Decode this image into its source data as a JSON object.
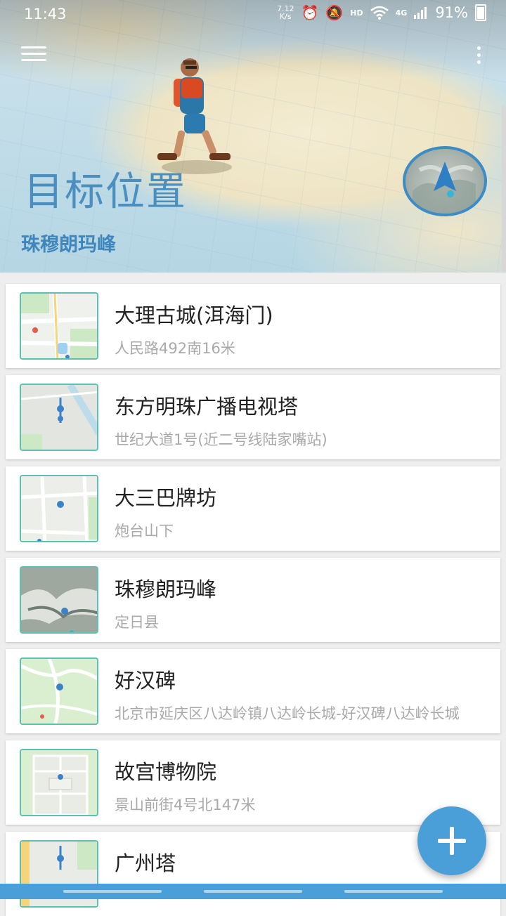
{
  "status_bar": {
    "time": "11:43",
    "net_speed_value": "7.12",
    "net_speed_unit": "K/s",
    "hd": "HD",
    "network": "4G",
    "battery": "91%",
    "icons": [
      "alarm-icon",
      "mute-icon",
      "wifi-icon",
      "signal-icon",
      "battery-icon"
    ]
  },
  "header": {
    "title": "目标位置",
    "current_target": "珠穆朗玛峰",
    "icons": [
      "menu-icon",
      "more-icon",
      "compass-icon"
    ]
  },
  "places": [
    {
      "name": "大理古城(洱海门)",
      "address": "人民路492南16米",
      "thumb": "map-thumbnail"
    },
    {
      "name": "东方明珠广播电视塔",
      "address": "世纪大道1号(近二号线陆家嘴站)",
      "thumb": "map-thumbnail"
    },
    {
      "name": "大三巴牌坊",
      "address": "炮台山下",
      "thumb": "map-thumbnail"
    },
    {
      "name": "珠穆朗玛峰",
      "address": "定日县",
      "thumb": "satellite-thumbnail"
    },
    {
      "name": "好汉碑",
      "address": "北京市延庆区八达岭镇八达岭长城-好汉碑八达岭长城",
      "thumb": "map-thumbnail"
    },
    {
      "name": "故宫博物院",
      "address": "景山前街4号北147米",
      "thumb": "map-thumbnail"
    },
    {
      "name": "广州塔",
      "address": "",
      "thumb": "map-thumbnail"
    }
  ],
  "colors": {
    "accent": "#4a9fd8",
    "title": "#4a8fc0",
    "thumb_border": "#5fbfb0"
  },
  "fab_icon": "plus-icon"
}
